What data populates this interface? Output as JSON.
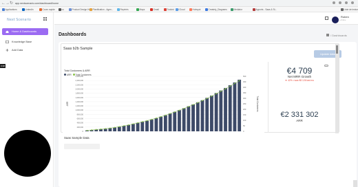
{
  "browser": {
    "url": "app.nextscenario.com/dashboard/home",
    "bookmarks": [
      {
        "label": "Applications",
        "color": "#4a7fd4"
      },
      {
        "label": "LinkedIn",
        "color": "#0a66c2"
      },
      {
        "label": "Cours rapide",
        "color": "#e56b2f"
      },
      {
        "label": "co",
        "color": "#555555"
      },
      {
        "label": "Product Design He...",
        "color": "#6b8fd6"
      },
      {
        "label": "Planification - Agen...",
        "color": "#e6a23c"
      },
      {
        "label": "Repérés",
        "color": "#5fb6e8"
      },
      {
        "label": "Maps",
        "color": "#34a853"
      },
      {
        "label": "Gmail",
        "color": "#d93025"
      },
      {
        "label": "Todoist",
        "color": "#db4035"
      },
      {
        "label": "iCloud",
        "color": "#5a9de8"
      },
      {
        "label": "Hubspot",
        "color": "#ff7a59"
      },
      {
        "label": "Creately_Diagrams",
        "color": "#3d7ae0"
      },
      {
        "label": "Mediator",
        "color": "#3a9b6a"
      },
      {
        "label": "Apports - Saas & St...",
        "color": "#b43c3c"
      },
      {
        "label": "Liste de lecture",
        "color": "#666666"
      }
    ]
  },
  "sidebar": {
    "logo": "Next Scenario",
    "items": [
      {
        "label": "Home & Dashboards",
        "active": true
      },
      {
        "label": "Knowledge Base",
        "active": false
      },
      {
        "label": "Add Data",
        "active": false
      }
    ]
  },
  "overlay": {
    "rec_time": "0:38"
  },
  "header": {
    "user_name": "Ruben",
    "user_sub": "● Online"
  },
  "page": {
    "title": "Dashboards",
    "breadcrumb": "Dashboards",
    "update_button": "Update data",
    "dashboard_title": "Saas b2b Sample",
    "sample_section": "Saas Sample Data"
  },
  "kpis": {
    "growth_value": "€4 709",
    "growth_label": "Net MRR Growth",
    "growth_change": "▼ 42% • was €8 126 last mo",
    "arr_value": "€2 331 302",
    "arr_label": "ARR"
  },
  "colors": {
    "accent": "#9b6bf2",
    "bar": "#3d4a68",
    "customers": "#8bc34a",
    "negative": "#e74c3c"
  },
  "chart_data": {
    "type": "bar",
    "title": "Total Customers & ARR",
    "legend": [
      "ARR",
      "Total Customers"
    ],
    "ylabel": "ARR",
    "y2label": "Total Customers",
    "yticks": [
      "2,600,000",
      "2,400,000",
      "2,200,000",
      "2,000,000",
      "1,800,000",
      "1,600,000",
      "1,400,000",
      "1,200,000",
      "1,000,000",
      "800,000",
      "600,000",
      "400,000",
      "200,000",
      "0"
    ],
    "y2ticks": [
      "500",
      "450",
      "400",
      "350",
      "300",
      "250",
      "200",
      "150",
      "100",
      "50",
      "0"
    ],
    "ylim": [
      0,
      2600000
    ],
    "y2lim": [
      0,
      500
    ],
    "series": [
      {
        "name": "ARR",
        "values": [
          40000,
          60000,
          80000,
          100000,
          120000,
          150000,
          180000,
          220000,
          260000,
          300000,
          350000,
          400000,
          450000,
          500000,
          560000,
          620000,
          690000,
          760000,
          840000,
          920000,
          1000000,
          1090000,
          1180000,
          1270000,
          1370000,
          1470000,
          1580000,
          1690000,
          1810000,
          1930000,
          2050000,
          2180000,
          2310000,
          2440000
        ]
      },
      {
        "name": "Total Customers",
        "values": [
          8,
          12,
          16,
          20,
          24,
          29,
          35,
          42,
          50,
          58,
          67,
          77,
          87,
          97,
          108,
          120,
          133,
          146,
          161,
          176,
          191,
          208,
          225,
          242,
          260,
          279,
          299,
          320,
          342,
          364,
          387,
          411,
          435,
          460
        ]
      }
    ]
  }
}
